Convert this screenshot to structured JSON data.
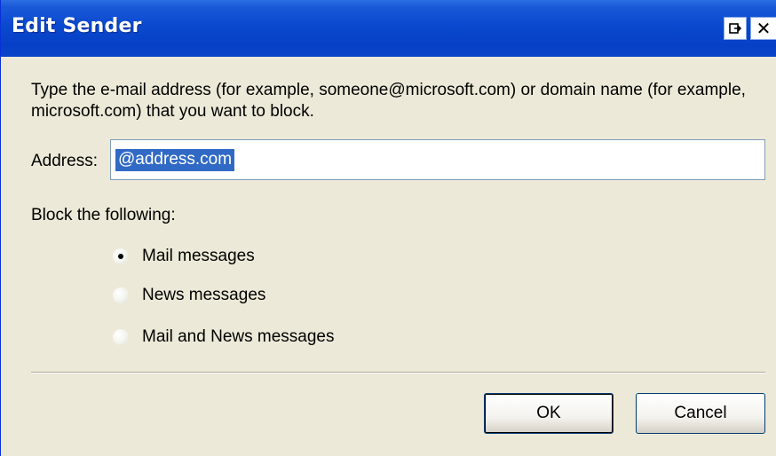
{
  "window": {
    "title": "Edit Sender"
  },
  "instructions": "Type the e-mail address (for example, someone@microsoft.com) or domain name (for example, microsoft.com) that you want to block.",
  "address": {
    "label": "Address:",
    "value": "@address.com"
  },
  "block": {
    "label": "Block the following:",
    "options": [
      {
        "label": "Mail messages",
        "selected": true
      },
      {
        "label": "News messages",
        "selected": false
      },
      {
        "label": "Mail and News messages",
        "selected": false
      }
    ]
  },
  "buttons": {
    "ok": "OK",
    "cancel": "Cancel"
  },
  "icons": {
    "dock": "dock-icon",
    "close": "close-icon"
  },
  "colors": {
    "titlebar": "#0a49cf",
    "selection": "#316ac5",
    "dialog_bg": "#ece9d8"
  }
}
